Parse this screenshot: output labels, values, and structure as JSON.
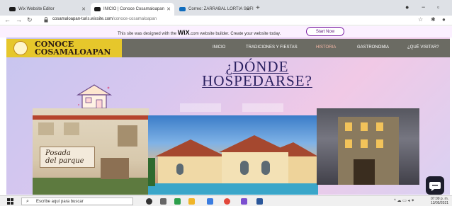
{
  "browser": {
    "tabs": [
      {
        "label": "Wix Website Editor",
        "favicon_color": "#1b1b1b",
        "active": false
      },
      {
        "label": "INICIO | Conoce Cosamaloapan",
        "favicon_color": "#1b1b1b",
        "active": true
      },
      {
        "label": "Correo: ZARRABAL LORTIA SOFI",
        "favicon_color": "#0f6cbd",
        "active": false
      }
    ],
    "new_tab_label": "+",
    "url_host": "cosamaloapan-turis.wixsite.com",
    "url_path": "/conoce-cosamaloapan"
  },
  "wix_banner": {
    "message_before": "This site was designed with the ",
    "brand": "WiX",
    "message_after": ".com website builder. Create your website today.",
    "cta": "Start Now"
  },
  "site": {
    "brand_line1": "CONOCE",
    "brand_line2": "COSAMALOAPAN",
    "menu": [
      "INICIO",
      "TRADICIONES Y FIESTAS",
      "HISTORIA",
      "GASTRONOMIA",
      "¿QUÉ VISITAR?"
    ],
    "active_menu": "HISTORIA",
    "heading_line1": "¿DÓNDE",
    "heading_line2": "HOSPEDARSE?",
    "hotel_sign_line1": "Posada",
    "hotel_sign_line2": "del parque",
    "colors": {
      "header_bg": "#6b6b63",
      "brand_bg": "#e6c72b",
      "heading": "#2a2060",
      "active_menu": "#f6b8a7"
    }
  },
  "taskbar": {
    "search_placeholder": "Escribe aquí para buscar",
    "time": "07:09 p. m.",
    "date": "13/05/2021"
  }
}
